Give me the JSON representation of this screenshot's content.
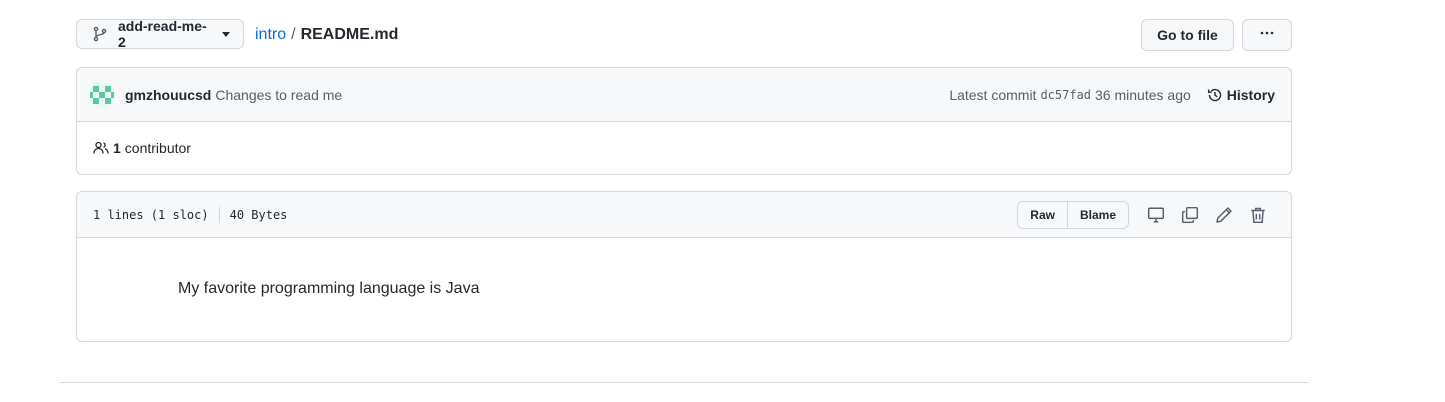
{
  "topbar": {
    "branch": "add-read-me-2",
    "branch_icon": "git-branch-icon",
    "repo": "intro",
    "separator": "/",
    "file": "README.md",
    "goto_label": "Go to file",
    "more_icon": "kebab-horizontal-icon"
  },
  "commit": {
    "author": "gmzhouucsd",
    "message": "Changes to read me",
    "latest_label": "Latest commit",
    "sha": "dc57fad",
    "time": "36 minutes ago",
    "history_label": "History"
  },
  "contributors": {
    "count": "1",
    "label": "contributor"
  },
  "file": {
    "lines": "1 lines (1 sloc)",
    "size": "40 Bytes",
    "raw_label": "Raw",
    "blame_label": "Blame",
    "content": "My favorite programming language is Java"
  },
  "colors": {
    "link": "#0969da",
    "border": "#d0d7de",
    "header_bg": "#f6f8fa",
    "muted": "#57606a",
    "text": "#24292f"
  }
}
